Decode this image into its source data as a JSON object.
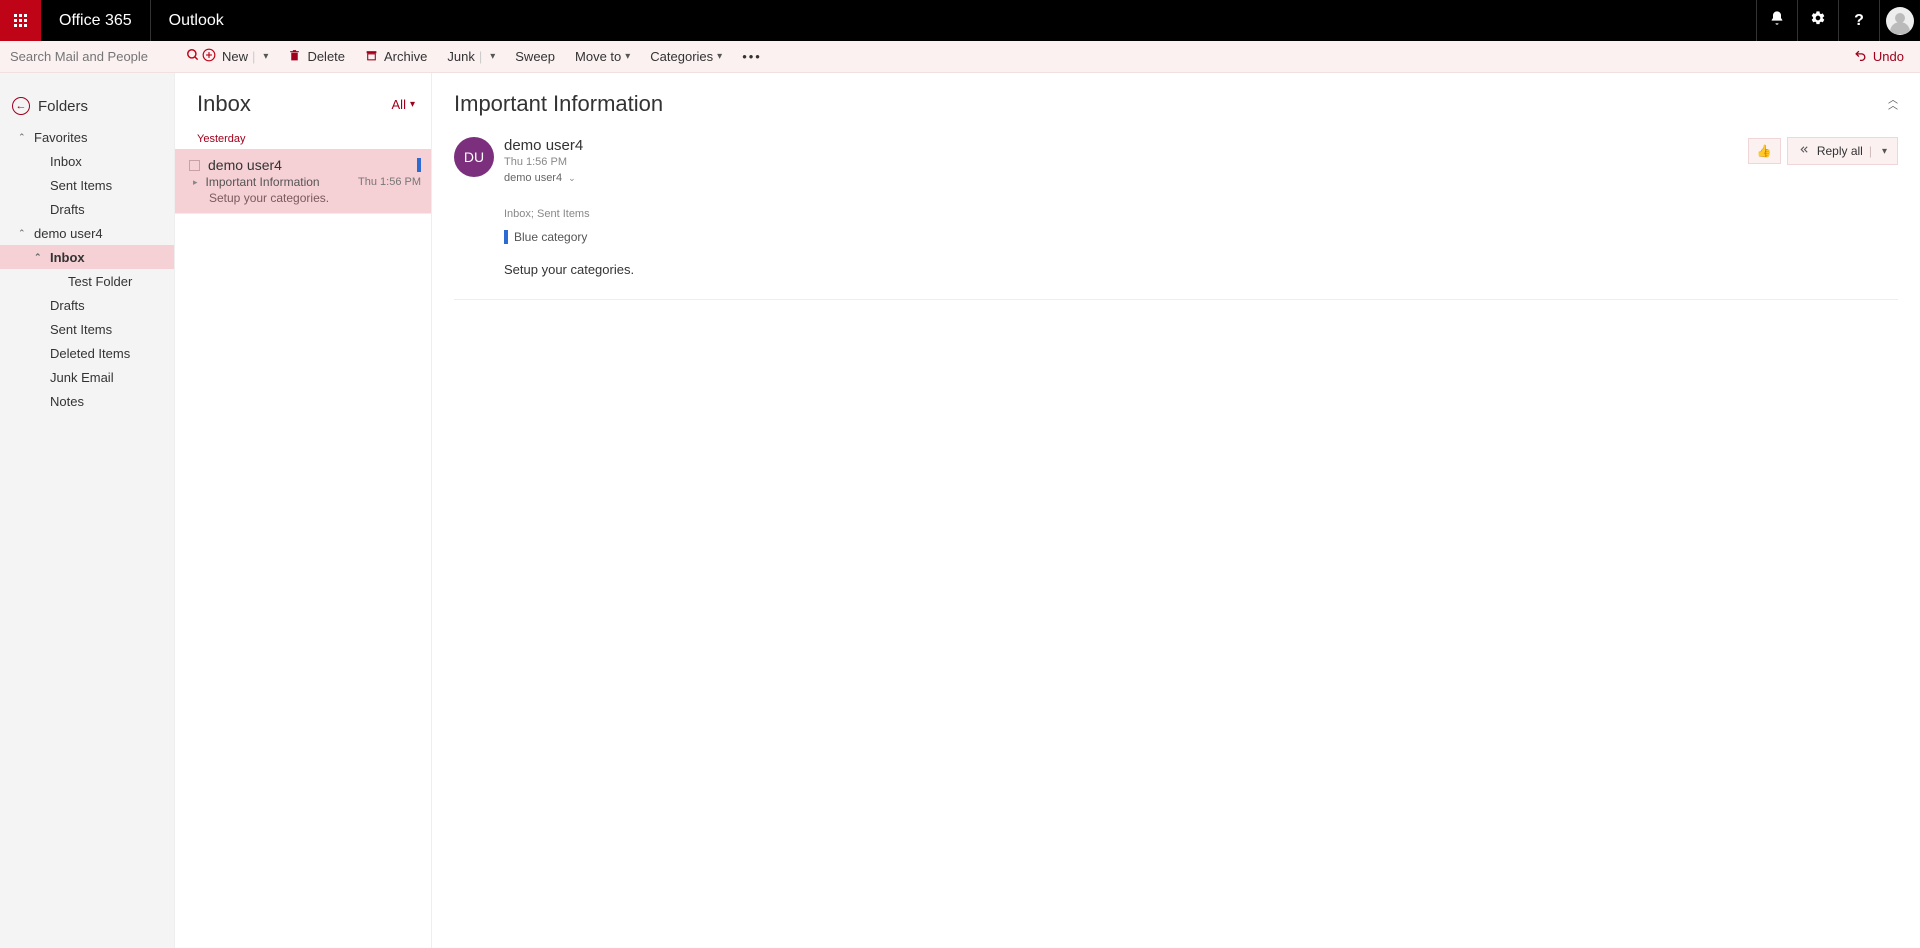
{
  "topbar": {
    "brand": "Office 365",
    "app": "Outlook"
  },
  "search": {
    "placeholder": "Search Mail and People"
  },
  "cmd": {
    "new": "New",
    "delete": "Delete",
    "archive": "Archive",
    "junk": "Junk",
    "sweep": "Sweep",
    "moveto": "Move to",
    "categories": "Categories",
    "undo": "Undo"
  },
  "sidebar": {
    "folders": "Folders",
    "favorites": "Favorites",
    "fav_inbox": "Inbox",
    "fav_sent": "Sent Items",
    "fav_drafts": "Drafts",
    "account": "demo user4",
    "inbox": "Inbox",
    "testfolder": "Test Folder",
    "drafts": "Drafts",
    "sent": "Sent Items",
    "deleted": "Deleted Items",
    "junk": "Junk Email",
    "notes": "Notes"
  },
  "msglist": {
    "title": "Inbox",
    "filter": "All",
    "group": "Yesterday",
    "item": {
      "from": "demo user4",
      "subject": "Important Information",
      "preview": "Setup your categories.",
      "time": "Thu 1:56 PM"
    }
  },
  "reading": {
    "title": "Important Information",
    "avatar": "DU",
    "sender": "demo user4",
    "time": "Thu 1:56 PM",
    "to": "demo user4",
    "like_glyph": "👍",
    "reply_all": "Reply all",
    "folders": "Inbox; Sent Items",
    "category": "Blue category",
    "body": "Setup your categories."
  }
}
